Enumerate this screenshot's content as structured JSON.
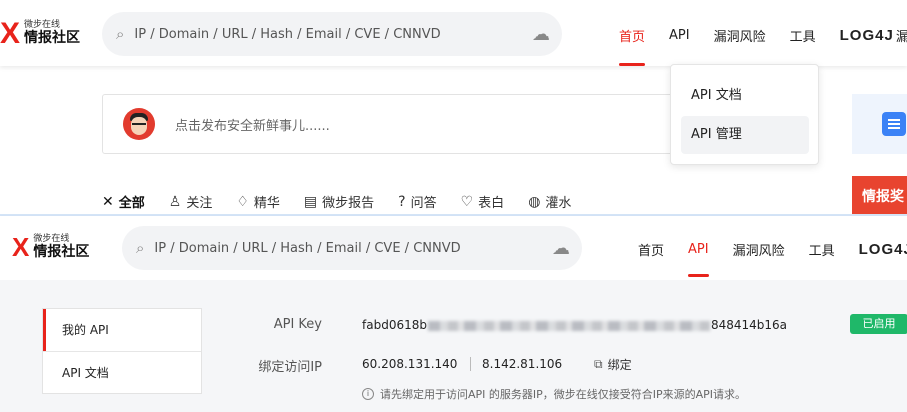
{
  "top": {
    "logo": {
      "mark": "X",
      "small": "微步在线",
      "big": "情报社区"
    },
    "search": {
      "placeholder": "IP / Domain / URL / Hash / Email / CVE / CNNVD",
      "icon": "search-icon",
      "upload_icon": "cloud-upload-icon"
    },
    "nav": [
      {
        "label": "首页",
        "active": true
      },
      {
        "label": "API",
        "active": false
      },
      {
        "label": "漏洞风险",
        "active": false
      },
      {
        "label": "工具",
        "active": false
      },
      {
        "label": "LOG4J",
        "active": false
      },
      {
        "label": "漏",
        "active": false
      }
    ],
    "dropdown": [
      {
        "label": "API 文档"
      },
      {
        "label": "API 管理"
      }
    ],
    "post": {
      "placeholder": "点击发布安全新鲜事儿......"
    },
    "side_red": "情报奖",
    "categories": [
      {
        "label": "全部",
        "icon": "x-logo-icon"
      },
      {
        "label": "关注",
        "icon": "user-follow-icon"
      },
      {
        "label": "精华",
        "icon": "diamond-icon"
      },
      {
        "label": "微步报告",
        "icon": "report-icon"
      },
      {
        "label": "问答",
        "icon": "question-icon"
      },
      {
        "label": "表白",
        "icon": "heart-icon"
      },
      {
        "label": "灌水",
        "icon": "water-drop-icon"
      }
    ]
  },
  "bottom": {
    "logo": {
      "mark": "X",
      "small": "微步在线",
      "big": "情报社区"
    },
    "search": {
      "placeholder": "IP / Domain / URL / Hash / Email / CVE / CNNVD"
    },
    "nav": [
      {
        "label": "首页",
        "active": false
      },
      {
        "label": "API",
        "active": true
      },
      {
        "label": "漏洞风险",
        "active": false
      },
      {
        "label": "工具",
        "active": false
      },
      {
        "label": "LOG4J",
        "active": false
      }
    ],
    "menu": [
      {
        "label": "我的 API",
        "active": true
      },
      {
        "label": "API 文档",
        "active": false
      }
    ],
    "api_key": {
      "label": "API Key",
      "prefix": "fabd0618b",
      "suffix": "848414b16a",
      "status": "已启用"
    },
    "bound_ip": {
      "label": "绑定访问IP",
      "ips": [
        "60.208.131.140",
        "8.142.81.106"
      ],
      "bind_label": "绑定",
      "hint": "请先绑定用于访问API 的服务器IP，微步在线仅接受符合IP来源的API请求。"
    }
  },
  "colors": {
    "brand": "#e8231b",
    "enabled": "#1fb869",
    "search_bg": "#f2f3f5"
  }
}
